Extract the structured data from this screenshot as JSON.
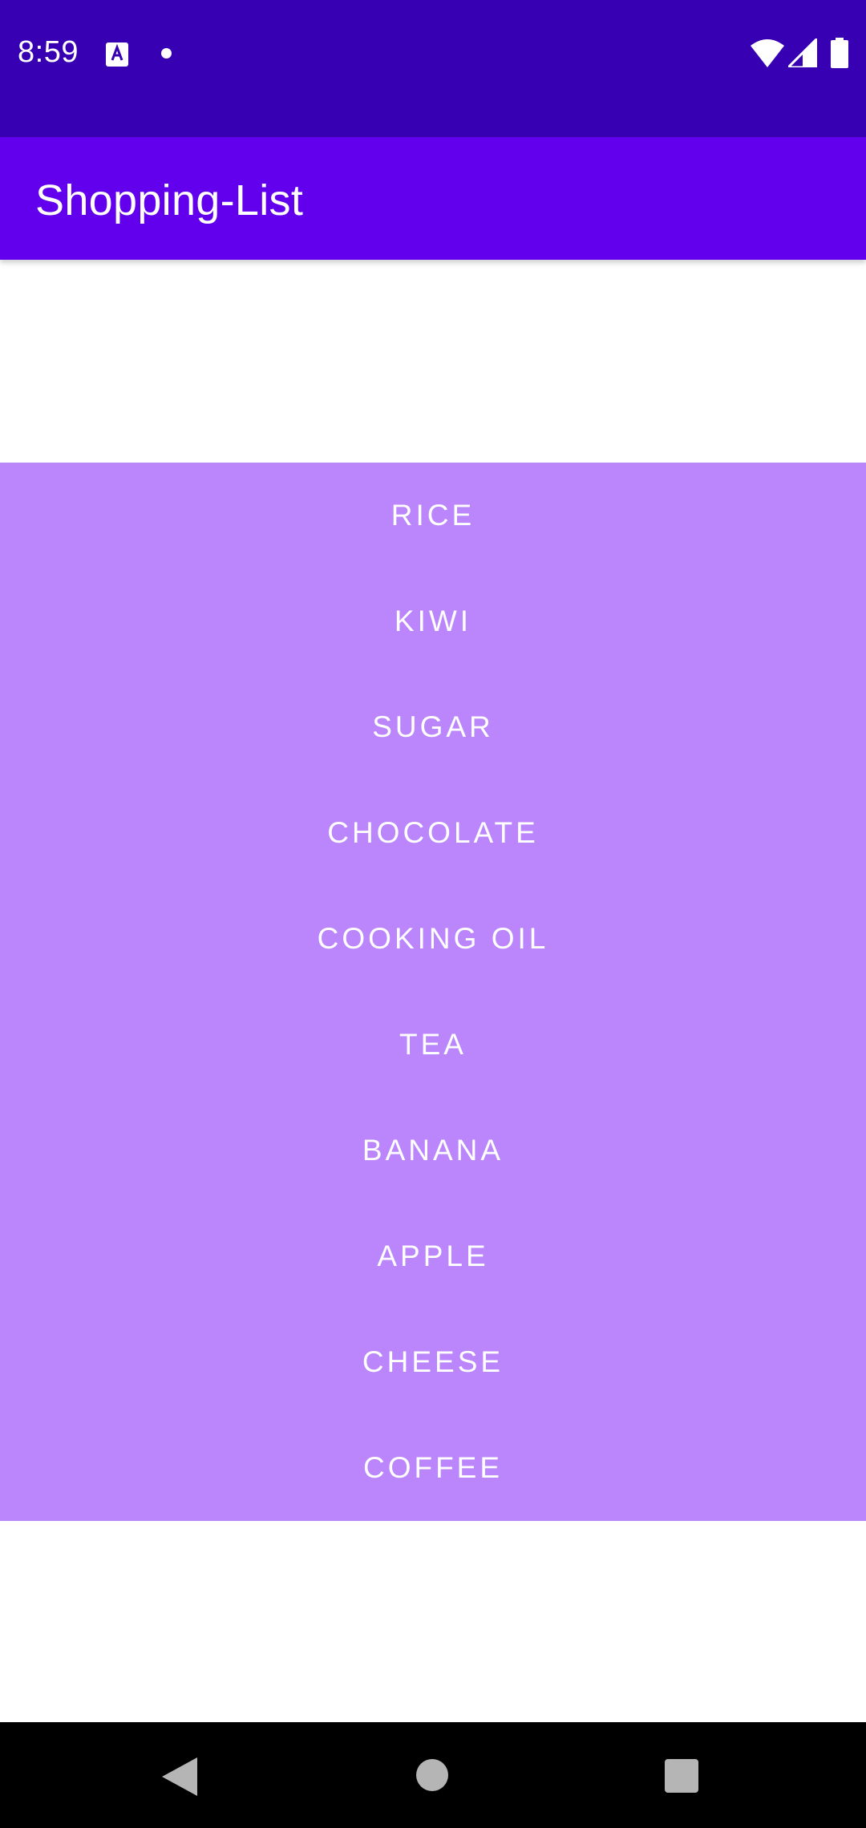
{
  "status_bar": {
    "time": "8:59",
    "icons": [
      "notification-a-icon",
      "dot-icon",
      "wifi-icon",
      "signal-icon",
      "battery-icon"
    ]
  },
  "app_bar": {
    "title": "Shopping-List"
  },
  "shopping_list": {
    "items": [
      {
        "label": "RICE"
      },
      {
        "label": "KIWI"
      },
      {
        "label": "SUGAR"
      },
      {
        "label": "CHOCOLATE"
      },
      {
        "label": "COOKING OIL"
      },
      {
        "label": "TEA"
      },
      {
        "label": "BANANA"
      },
      {
        "label": "APPLE"
      },
      {
        "label": "CHEESE"
      },
      {
        "label": "COFFEE"
      }
    ]
  },
  "nav_bar": {
    "icons": [
      "back-icon",
      "home-icon",
      "recents-icon"
    ]
  },
  "colors": {
    "status_bar": "#3700b3",
    "app_bar": "#6200ee",
    "list_background": "#bb86fc",
    "list_text": "#ffffff",
    "nav_bar": "#000000"
  }
}
